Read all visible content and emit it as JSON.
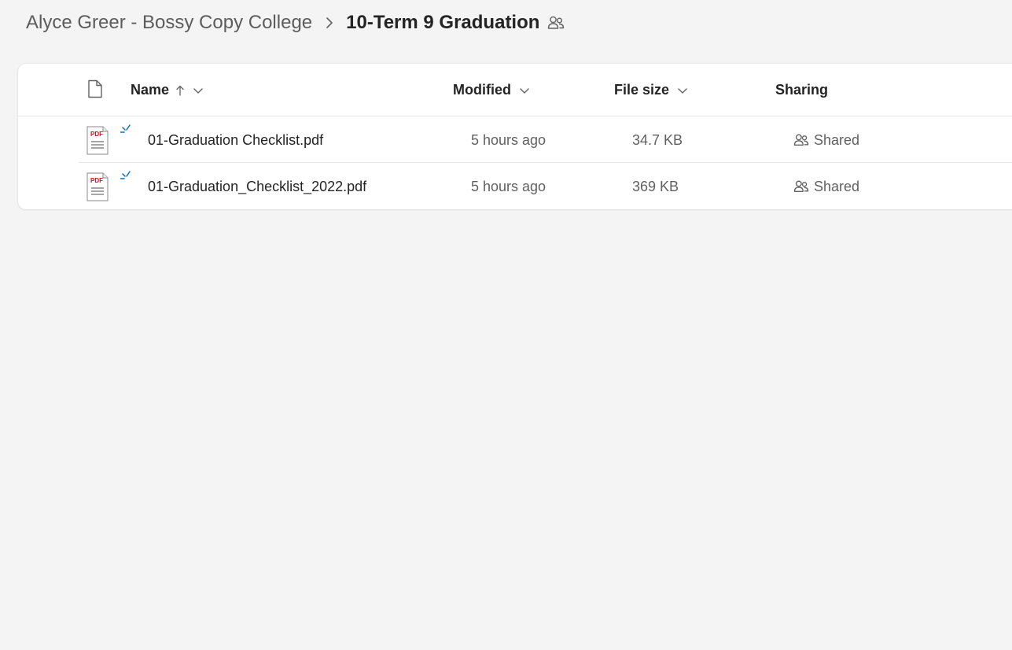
{
  "breadcrumb": {
    "parent": "Alyce Greer - Bossy Copy College",
    "separator_icon": "chevron-right-icon",
    "current": "10-Term 9 Graduation",
    "shared_icon": "people-icon"
  },
  "columns": {
    "type_icon": "document-icon",
    "name": "Name",
    "name_sort": "ascending",
    "modified": "Modified",
    "size": "File size",
    "sharing": "Sharing"
  },
  "files": [
    {
      "name": "01-Graduation Checklist.pdf",
      "modified": "5 hours ago",
      "size": "34.7 KB",
      "sharing": "Shared",
      "icon": "pdf-file-icon",
      "badge": "new-file-sparkle-icon"
    },
    {
      "name": "01-Graduation_Checklist_2022.pdf",
      "modified": "5 hours ago",
      "size": "369 KB",
      "sharing": "Shared",
      "icon": "pdf-file-icon",
      "badge": "new-file-sparkle-icon"
    }
  ],
  "colors": {
    "background": "#f4f4f4",
    "panel": "#ffffff",
    "text": "#242424",
    "muted": "#616161",
    "pdf_red": "#c4161c",
    "badge_blue": "#0f6cbd"
  }
}
